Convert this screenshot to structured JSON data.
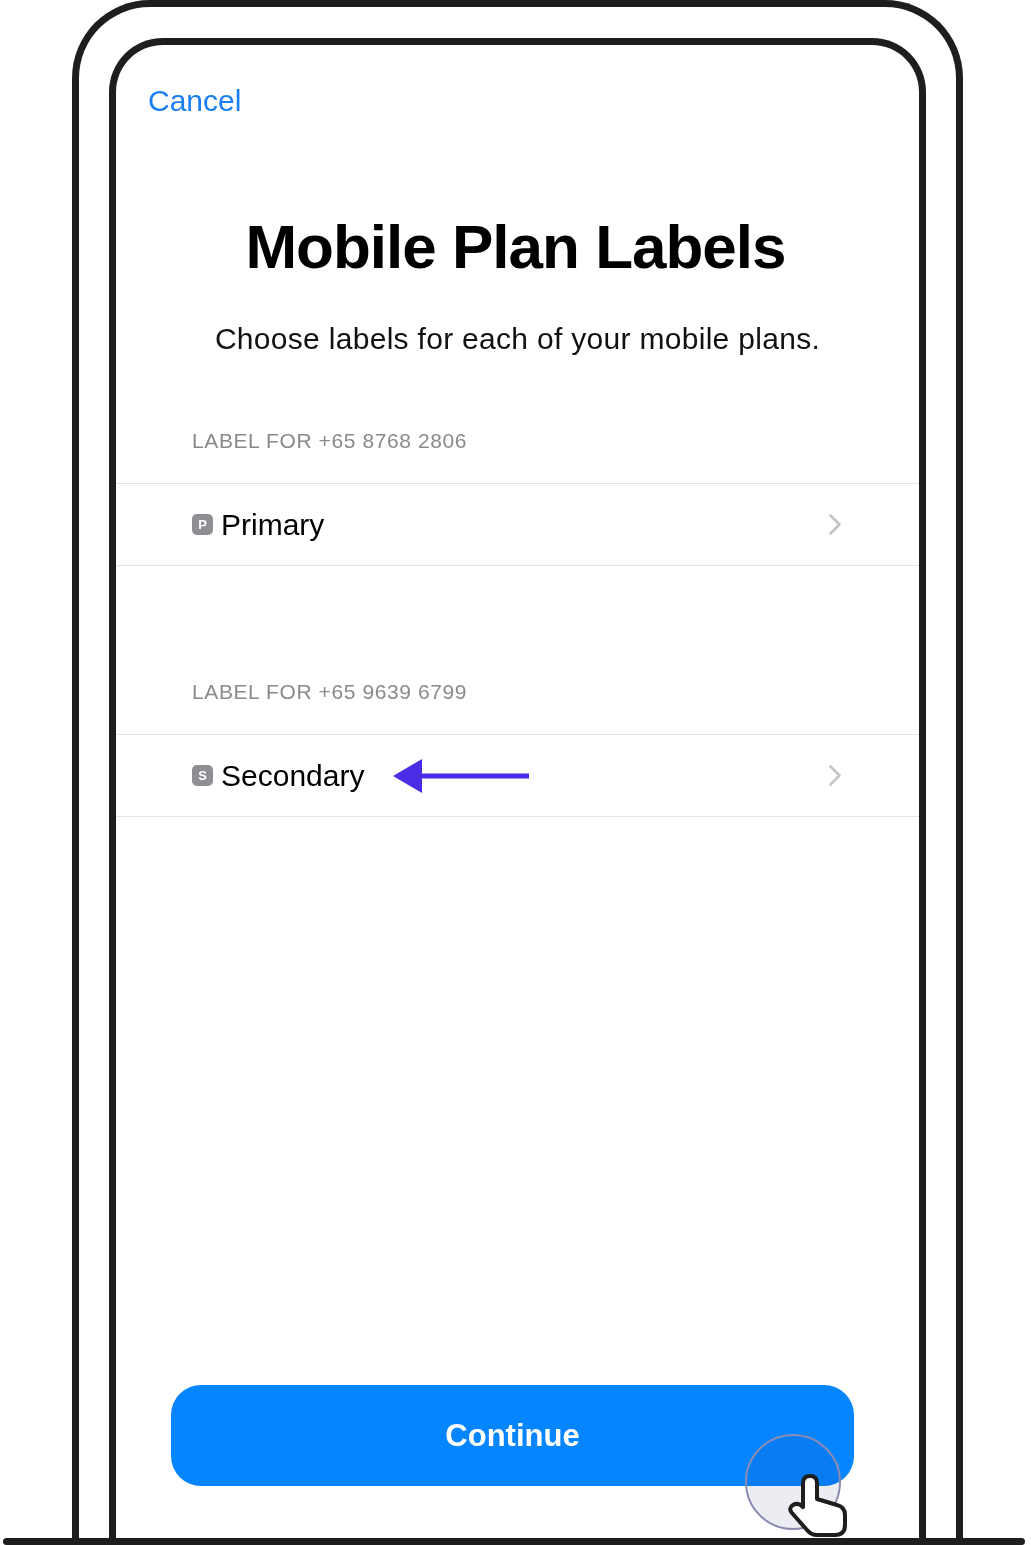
{
  "nav": {
    "cancel": "Cancel"
  },
  "title": "Mobile Plan Labels",
  "subtitle": "Choose labels for each of your mobile plans.",
  "sections": [
    {
      "header": "LABEL FOR +65 8768 2806",
      "row": {
        "badge": "P",
        "label": "Primary",
        "annotated": false
      }
    },
    {
      "header": "LABEL FOR +65 9639 6799",
      "row": {
        "badge": "S",
        "label": "Secondary",
        "annotated": true
      }
    }
  ],
  "continue_button": {
    "label": "Continue",
    "tapped": true
  }
}
